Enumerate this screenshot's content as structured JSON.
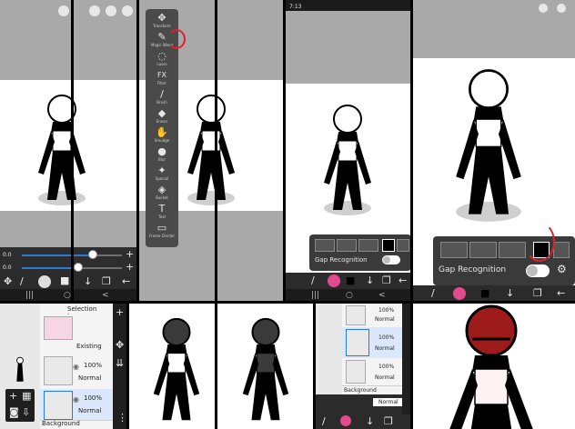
{
  "panel1": {
    "sliders": [
      {
        "label": "0.0",
        "value": 0.7
      },
      {
        "label": "0.0",
        "value": 0.55
      }
    ],
    "plus": "+",
    "minus": "−",
    "nav": [
      "|||",
      "○",
      "<"
    ]
  },
  "panel2": {
    "tool_menu": [
      {
        "icon": "✥",
        "label": "Transform"
      },
      {
        "icon": "✎",
        "label": "Magic Wand"
      },
      {
        "icon": "◌",
        "label": "Lasso"
      },
      {
        "icon": "FX",
        "label": "Filter"
      },
      {
        "icon": "/",
        "label": "Brush"
      },
      {
        "icon": "◆",
        "label": "Eraser"
      },
      {
        "icon": "✋",
        "label": "Smudge"
      },
      {
        "icon": "●",
        "label": "Blur"
      },
      {
        "icon": "✦",
        "label": "Special"
      },
      {
        "icon": "◈",
        "label": "Bucket"
      },
      {
        "icon": "T",
        "label": "Text"
      },
      {
        "icon": "▭",
        "label": "Frame Divider"
      }
    ]
  },
  "panel3": {
    "status_time": "7:13",
    "gap_recognition": "Gap Recognition",
    "nav": [
      "|||",
      "○",
      "<"
    ]
  },
  "panel4": {
    "gap_recognition": "Gap Recognition",
    "nav": [
      "|||",
      "○",
      "<"
    ]
  },
  "panel5": {
    "header": "Selection Layer",
    "layers": [
      {
        "name": "Existing",
        "opacity": "",
        "blend": ""
      },
      {
        "name": "",
        "opacity": "100%",
        "blend": "Normal"
      },
      {
        "name": "",
        "opacity": "100%",
        "blend": "Normal"
      }
    ],
    "background_label": "Background"
  },
  "panel7": {
    "layers": [
      {
        "opacity": "100%",
        "blend": "Normal"
      },
      {
        "opacity": "100%",
        "blend": "Normal"
      },
      {
        "opacity": "100%",
        "blend": "Normal"
      }
    ],
    "background_label": "Background",
    "blend_select": "Normal"
  },
  "colors": {
    "toolbar": "#2b2b2b",
    "canvas_gray": "#a9a9a9",
    "accent_blue": "#2a7bd8",
    "annotation_red": "#e0202a",
    "character_red": "#9e1b1b"
  }
}
